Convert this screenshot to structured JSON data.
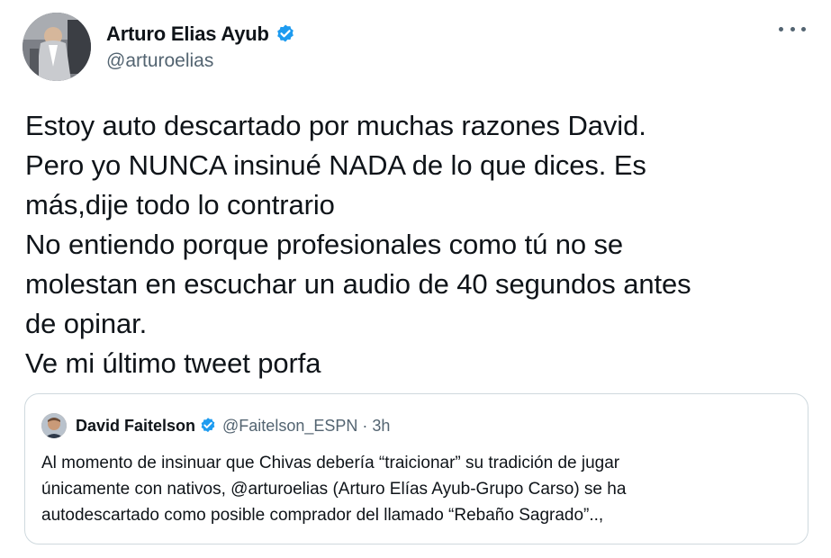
{
  "tweet": {
    "author": {
      "name": "Arturo Elias Ayub",
      "handle": "@arturoelias",
      "verified": true
    },
    "more_icon": "more-horizontal-icon",
    "body_lines": [
      "Estoy auto descartado por muchas razones David.",
      "Pero yo NUNCA insinué NADA de lo que dices. Es",
      "más,dije todo lo contrario",
      "No entiendo porque profesionales como tú no se",
      "molestan en escuchar un audio de 40 segundos antes",
      "de opinar.",
      "Ve mi último tweet porfa"
    ]
  },
  "quoted_tweet": {
    "author": {
      "name": "David Faitelson",
      "handle": "@Faitelson_ESPN",
      "verified": true
    },
    "separator": "·",
    "time": "3h",
    "text_lines": [
      "Al momento de insinuar que Chivas debería “traicionar” su tradición de jugar",
      "únicamente con nativos, @arturoelias (Arturo Elías Ayub-Grupo Carso) se ha",
      "autodescartado como posible comprador del llamado “Rebaño Sagrado”..,"
    ]
  },
  "colors": {
    "verified_blue": "#1d9bf0",
    "text_primary": "#0f1419",
    "text_secondary": "#536471",
    "border": "#cfd9de"
  }
}
